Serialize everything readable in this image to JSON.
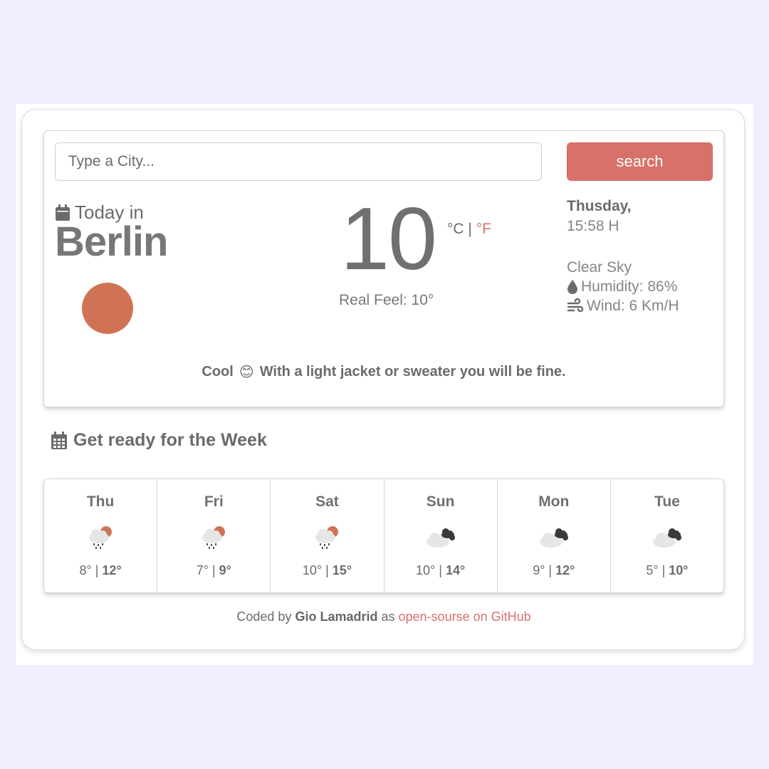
{
  "search": {
    "placeholder": "Type a City...",
    "button_label": "search"
  },
  "today": {
    "label": "Today in",
    "city": "Berlin",
    "temperature": "10",
    "unit_c": "°C",
    "unit_sep": "|",
    "unit_f": "°F",
    "real_feel": "Real Feel: 10°",
    "day": "Thusday,",
    "time": "15:58 H",
    "description": "Clear Sky",
    "humidity": "Humidity: 86%",
    "wind": "Wind: 6 Km/H",
    "tip_lead": "Cool",
    "tip_emoji": "😊",
    "tip_text": "With a light jacket or sweater you will be fine."
  },
  "week": {
    "title": "Get ready for the Week",
    "days": [
      {
        "name": "Thu",
        "icon": "rain-cloud-sun-icon",
        "min": "8°",
        "max": "12°"
      },
      {
        "name": "Fri",
        "icon": "rain-cloud-sun-icon",
        "min": "7°",
        "max": "9°"
      },
      {
        "name": "Sat",
        "icon": "rain-cloud-sun-icon",
        "min": "10°",
        "max": "15°"
      },
      {
        "name": "Sun",
        "icon": "cloudy-icon",
        "min": "10°",
        "max": "14°"
      },
      {
        "name": "Mon",
        "icon": "cloudy-icon",
        "min": "9°",
        "max": "12°"
      },
      {
        "name": "Tue",
        "icon": "cloudy-icon",
        "min": "5°",
        "max": "10°"
      }
    ]
  },
  "footer": {
    "prefix": "Coded by",
    "author": "Gio Lamadrid",
    "middle": "as",
    "link_text": "open-sourse on GitHub"
  },
  "colors": {
    "accent": "#d8716a",
    "sun": "#d07355",
    "background": "#f0effd"
  }
}
